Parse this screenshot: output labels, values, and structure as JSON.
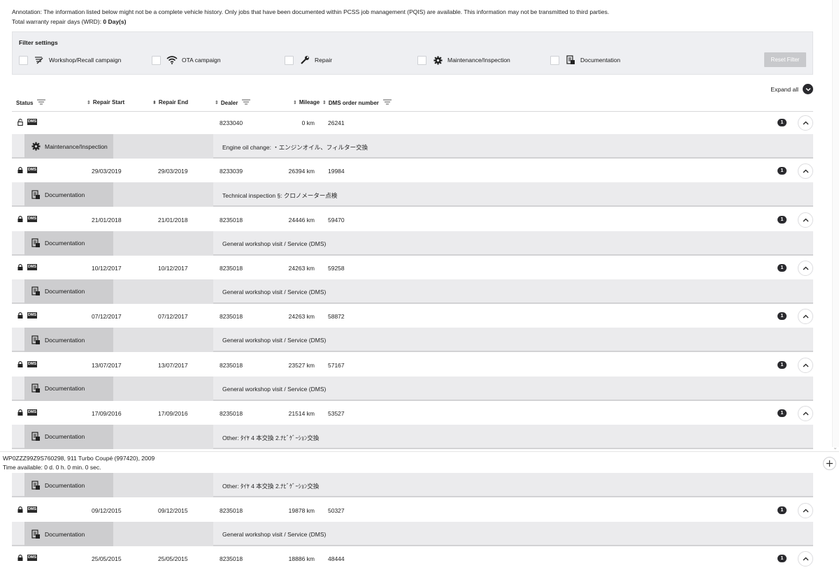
{
  "notice": {
    "line1": "Annotation: The information listed below might not be a complete vehicle history. Only jobs that have been documented within PCSS job management (PQIS) are available. This information may not be transmitted to third parties.",
    "line2_label": "Total warranty repair days (WRD): ",
    "line2_value": "0 Day(s)"
  },
  "filter": {
    "title": "Filter settings",
    "options": [
      {
        "label": "Workshop/Recall campaign",
        "icon": "recall-icon"
      },
      {
        "label": "OTA campaign",
        "icon": "wifi-icon"
      },
      {
        "label": "Repair",
        "icon": "wrench-icon"
      },
      {
        "label": "Maintenance/Inspection",
        "icon": "gear-icon"
      },
      {
        "label": "Documentation",
        "icon": "document-icon"
      }
    ],
    "reset_label": "Reset Filter"
  },
  "expand_all_label": "Expand all",
  "columns": {
    "status": "Status",
    "repair_start": "Repair Start",
    "repair_end": "Repair End",
    "dealer": "Dealer",
    "mileage": "Mileage",
    "dms_order": "DMS order number"
  },
  "dms_badge": "DMS",
  "rows": [
    {
      "start": "",
      "end": "",
      "dealer": "8233040",
      "mileage": "0 km",
      "order": "26241",
      "count": "1",
      "sub_type": "Maintenance/Inspection",
      "sub_icon": "gear-icon",
      "desc": "Engine oil change: ・エンジンオイル、フィルター交換",
      "locked": false
    },
    {
      "start": "29/03/2019",
      "end": "29/03/2019",
      "dealer": "8233039",
      "mileage": "26394 km",
      "order": "19984",
      "count": "1",
      "sub_type": "Documentation",
      "sub_icon": "document-icon",
      "desc": "Technical inspection §: クロノメーター点検",
      "locked": true
    },
    {
      "start": "21/01/2018",
      "end": "21/01/2018",
      "dealer": "8235018",
      "mileage": "24446 km",
      "order": "59470",
      "count": "1",
      "sub_type": "Documentation",
      "sub_icon": "document-icon",
      "desc": "General workshop visit / Service (DMS)",
      "locked": true
    },
    {
      "start": "10/12/2017",
      "end": "10/12/2017",
      "dealer": "8235018",
      "mileage": "24263 km",
      "order": "59258",
      "count": "1",
      "sub_type": "Documentation",
      "sub_icon": "document-icon",
      "desc": "General workshop visit / Service (DMS)",
      "locked": true
    },
    {
      "start": "07/12/2017",
      "end": "07/12/2017",
      "dealer": "8235018",
      "mileage": "24263 km",
      "order": "58872",
      "count": "1",
      "sub_type": "Documentation",
      "sub_icon": "document-icon",
      "desc": "General workshop visit / Service (DMS)",
      "locked": true
    },
    {
      "start": "13/07/2017",
      "end": "13/07/2017",
      "dealer": "8235018",
      "mileage": "23527 km",
      "order": "57167",
      "count": "1",
      "sub_type": "Documentation",
      "sub_icon": "document-icon",
      "desc": "General workshop visit / Service (DMS)",
      "locked": true
    },
    {
      "start": "17/09/2016",
      "end": "17/09/2016",
      "dealer": "8235018",
      "mileage": "21514 km",
      "order": "53527",
      "count": "1",
      "sub_type": "Documentation",
      "sub_icon": "document-icon",
      "desc": "Other: ﾀｲﾔ 4 本交換 2.ﾅﾋﾞｹﾞｰｼｮﾝ交換",
      "locked": true
    }
  ],
  "orphan_sub": {
    "sub_type": "Documentation",
    "sub_icon": "document-icon",
    "desc": "Other: ﾀｲﾔ 4 本交換 2.ﾅﾋﾞｹﾞｰｼｮﾝ交換"
  },
  "rows_after": [
    {
      "start": "09/12/2015",
      "end": "09/12/2015",
      "dealer": "8235018",
      "mileage": "19878 km",
      "order": "50327",
      "count": "1",
      "sub_type": "Documentation",
      "sub_icon": "document-icon",
      "desc": "General workshop visit / Service (DMS)",
      "locked": true
    },
    {
      "start": "25/05/2015",
      "end": "25/05/2015",
      "dealer": "8235018",
      "mileage": "18886 km",
      "order": "48444",
      "count": "1",
      "locked": true
    }
  ],
  "vehicle": {
    "line1": "WP0ZZZ99Z9S760298, 911 Turbo Coupé (997420), 2009",
    "line2": "Time available: 0 d. 0 h. 0 min. 0 sec."
  }
}
